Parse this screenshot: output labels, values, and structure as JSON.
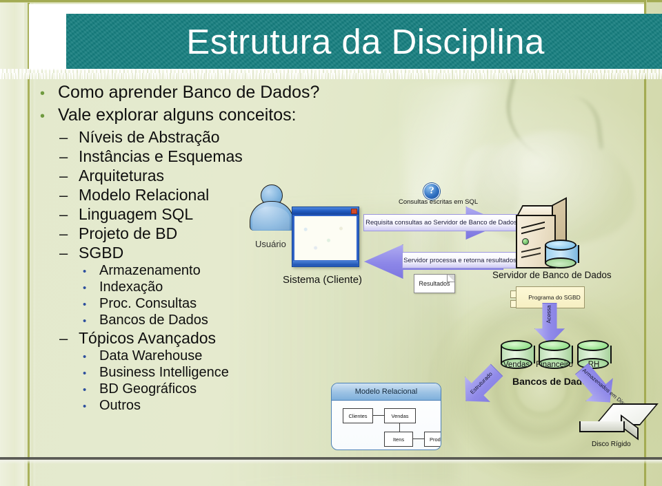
{
  "slide": {
    "title": "Estrutura da Disciplina",
    "theme": {
      "title_band": "#167f80",
      "title_text": "#ffffff",
      "frame_rule": "#a3ab53",
      "background": "#e3e9cd",
      "bullet_level1": "#6f9a3f",
      "bullet_level2": "#171717",
      "bullet_level3": "#2d4f9e",
      "arrow_fill": "#8d87e8",
      "cylinder_fill": "#93e08a"
    }
  },
  "bullets": [
    {
      "level": 1,
      "marker": "•",
      "text": "Como aprender Banco de Dados?"
    },
    {
      "level": 1,
      "marker": "•",
      "text": "Vale explorar alguns conceitos:"
    },
    {
      "level": 2,
      "marker": "–",
      "text": "Níveis de Abstração"
    },
    {
      "level": 2,
      "marker": "–",
      "text": "Instâncias e Esquemas"
    },
    {
      "level": 2,
      "marker": "–",
      "text": "Arquiteturas"
    },
    {
      "level": 2,
      "marker": "–",
      "text": "Modelo Relacional"
    },
    {
      "level": 2,
      "marker": "–",
      "text": "Linguagem SQL"
    },
    {
      "level": 2,
      "marker": "–",
      "text": "Projeto de BD"
    },
    {
      "level": 2,
      "marker": "–",
      "text": "SGBD"
    },
    {
      "level": 3,
      "marker": "•",
      "text": "Armazenamento"
    },
    {
      "level": 3,
      "marker": "•",
      "text": "Indexação"
    },
    {
      "level": 3,
      "marker": "•",
      "text": "Proc. Consultas"
    },
    {
      "level": 3,
      "marker": "•",
      "text": "Bancos de Dados"
    },
    {
      "level": 2,
      "marker": "–",
      "text": "Tópicos Avançados"
    },
    {
      "level": 3,
      "marker": "•",
      "text": "Data Warehouse"
    },
    {
      "level": 3,
      "marker": "•",
      "text": "Business Intelligence"
    },
    {
      "level": 3,
      "marker": "•",
      "text": "BD Geográficos"
    },
    {
      "level": 3,
      "marker": "•",
      "text": "Outros"
    }
  ],
  "diagram": {
    "user_label": "Usuário",
    "client_label": "Sistema (Cliente)",
    "sql_note": "Consultas escritas em SQL",
    "request_arrow": "Requisita consultas ao Servidor de Banco de Dados",
    "response_arrow": "Servidor processa e retorna resultados",
    "results_note": "Resultados",
    "server_label": "Servidor de Banco de Dados",
    "dbms_component": "Programa do SGBD",
    "access_arrow": "Acessa",
    "structured_arrow": "Estruturado",
    "stored_arrow": "Armazenados em Disco",
    "databases_label": "Bancos de Dados",
    "databases": [
      "Vendas",
      "Financeiro",
      "RH"
    ],
    "relational_model": {
      "title": "Modelo Relacional",
      "tables": [
        "Clientes",
        "Vendas",
        "Itens",
        "Produtos"
      ]
    },
    "disk_label": "Disco Rígido"
  }
}
